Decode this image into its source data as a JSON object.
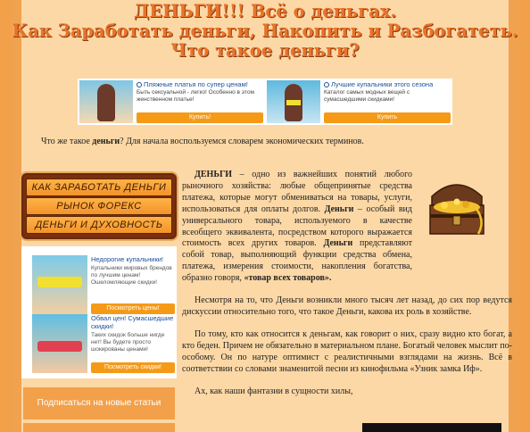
{
  "header": {
    "line1": "ДЕНЬГИ!!! Всё о деньгах.",
    "line2": "Как Заработать деньги, Накопить и Разбогатеть.",
    "line3": "Что такое деньги?"
  },
  "top_ads": [
    {
      "title": "Пляжные платья по супер ценам!",
      "desc": "Быть сексуальной - легко! Особенно в этом женственном платье!",
      "button": "Купить!"
    },
    {
      "title": "Лучшие купальники этого сезона",
      "desc": "Каталог самых модных вещей с сумасшедшими скидками!",
      "button": "Купить"
    }
  ],
  "intro": {
    "before": "Что же такое ",
    "bold": "деньги",
    "after": "? Для начала воспользуемся словарем экономических терминов."
  },
  "menu": [
    "КАК ЗАРАБОТАТЬ ДЕНЬГИ",
    "РЫНОК ФОРЕКС",
    "ДЕНЬГИ И ДУХОВНОСТЬ"
  ],
  "side_ads": [
    {
      "title": "Недорогие купальники!",
      "desc": "Купальники мировых брендов по лучшим ценам! Ошеломляющие скидки!",
      "button": "Посмотреть цены!"
    },
    {
      "title": "Обвал цен! Сумасшедшие скидки!",
      "desc": "Таких скидок больше нигде нет! Вы будете просто шокированы ценами!",
      "button": "Посмотреть скидки!"
    }
  ],
  "subscribe": "Подписаться на новые статьи",
  "article": {
    "p1_b1": "ДЕНЬГИ",
    "p1_t1": " – одно из важнейших понятий любого рыночного хозяйства: любые общепринятые средства платежа, которые могут обмениваться на товары, услуги, использоваться для оплаты долгов. ",
    "p1_b2": "Деньги",
    "p1_t2": " – особый вид универсального товара, используемого в качестве всеобщего эквивалента, посредством которого выражается стоимость всех других товаров. ",
    "p1_b3": "Деньги",
    "p1_t3": " представляют собой товар, выполняющий функции средства обмена, платежа, измерения стоимости, накопления богатства, образно говоря, ",
    "p1_b4": "«товар всех товаров».",
    "p2": "Несмотря на то, что Деньги возникли много тысяч лет назад, до сих пор ведутся дискуссии относительно того, что такое Деньги, какова их роль в хозяйстве.",
    "p3": "По тому, кто как относится к деньгам, как говорит о них, сразу видно кто богат, а кто беден. Причем не обязательно в материальном плане. Богатый человек мыслит по-особому. Он по натуре оптимист с реалистичными взглядами на жизнь. Всё в соответствии со словами знаменитой песни из кинофильма «Узник замка Иф».",
    "p4": "Ах, как наши фантазии в сущности хилы,"
  },
  "colors": {
    "background": "#f3a04a",
    "panel": "#fcd8a6",
    "header_text": "#e8742a",
    "ad_button": "#f59a17",
    "ad_link": "#1a4f9c"
  }
}
